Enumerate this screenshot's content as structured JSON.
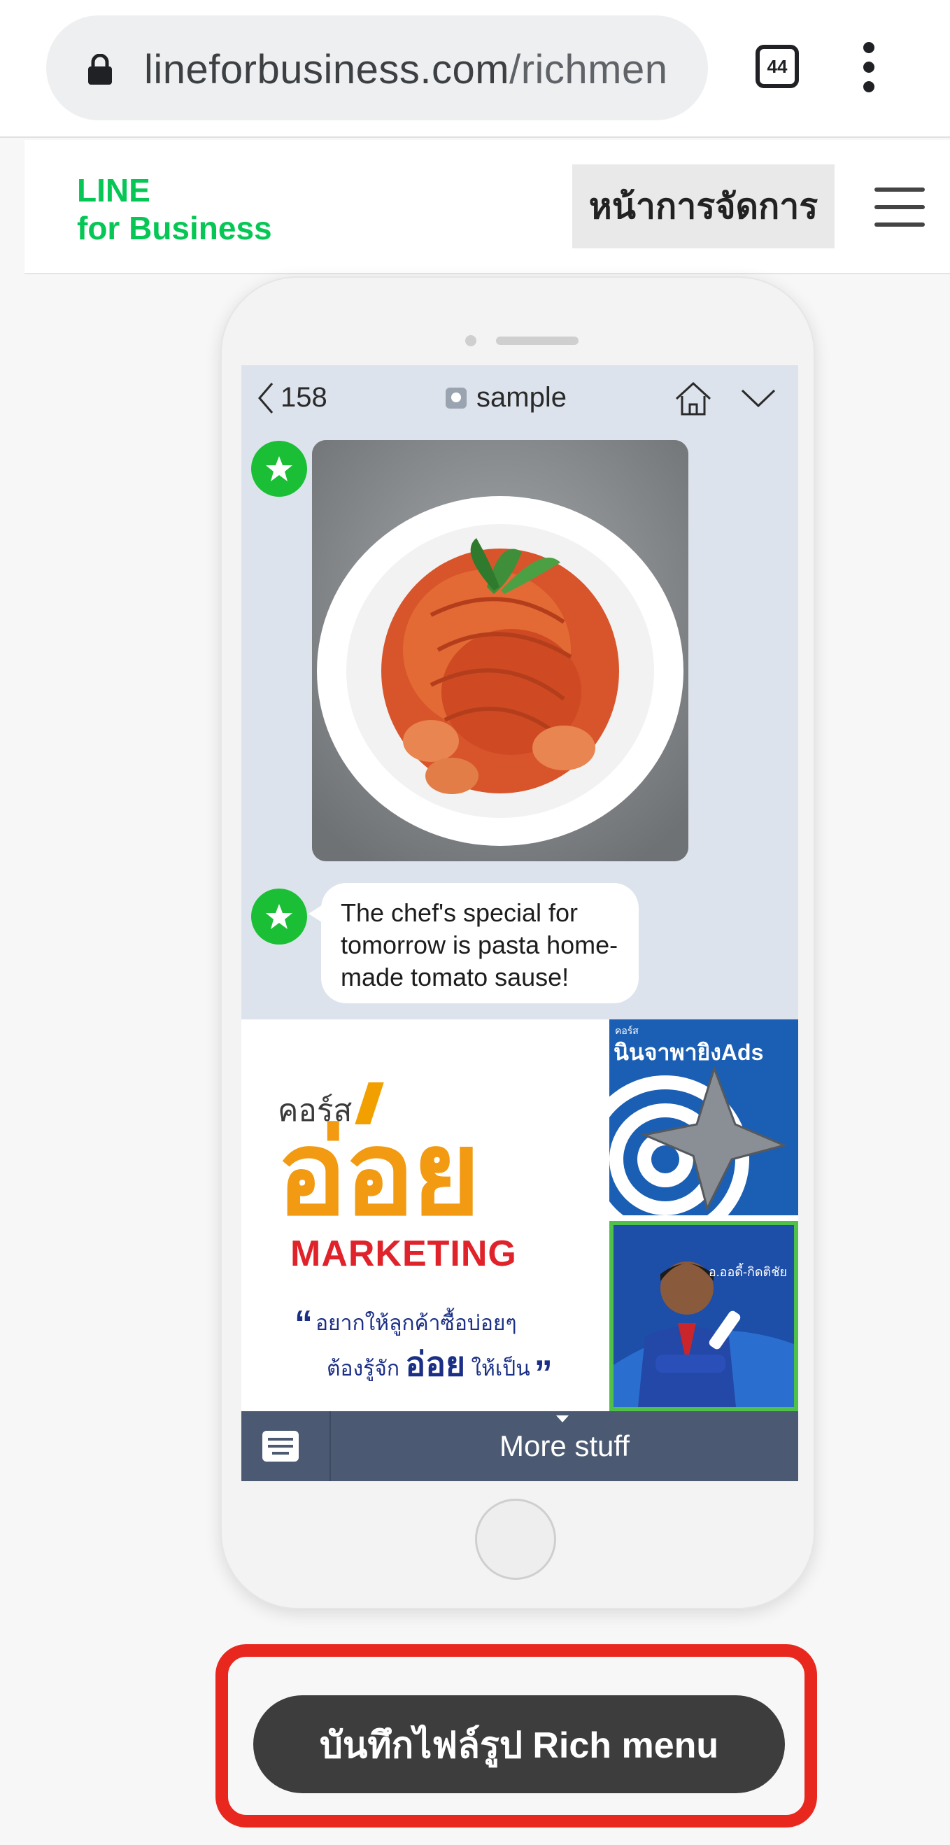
{
  "browser": {
    "url_host": "lineforbusiness.com",
    "url_path": "/richmen",
    "tab_count": "44"
  },
  "site": {
    "logo_line1": "LINE",
    "logo_line2": "for Business",
    "manage_button": "หน้าการจัดการ",
    "brand_color": "#06c755"
  },
  "chat": {
    "back_count": "158",
    "title": "sample",
    "message": "The chef's special for tomorrow is pasta home-made tomato sause!",
    "food_image_icon": "pasta-photo"
  },
  "rich_menu": {
    "course_label": "คอร์ส",
    "brand_word": "อ่อย",
    "marketing": "MARKETING",
    "quote_line1": "อยากให้ลูกค้าซื้อบ่อยๆ",
    "quote_line2_prefix": "ต้องรู้จัก",
    "quote_line2_big": "อ่อย",
    "quote_line2_suffix": "ให้เป็น",
    "tile1_small": "คอร์ส",
    "tile1_title": "นินจาพายิงAds",
    "tile2_text": "อ.ออดี้-กิดติชัย",
    "bar_label": "More stuff"
  },
  "actions": {
    "save_button": "บันทึกไฟล์รูป Rich menu",
    "highlight_color": "#e8281f"
  }
}
